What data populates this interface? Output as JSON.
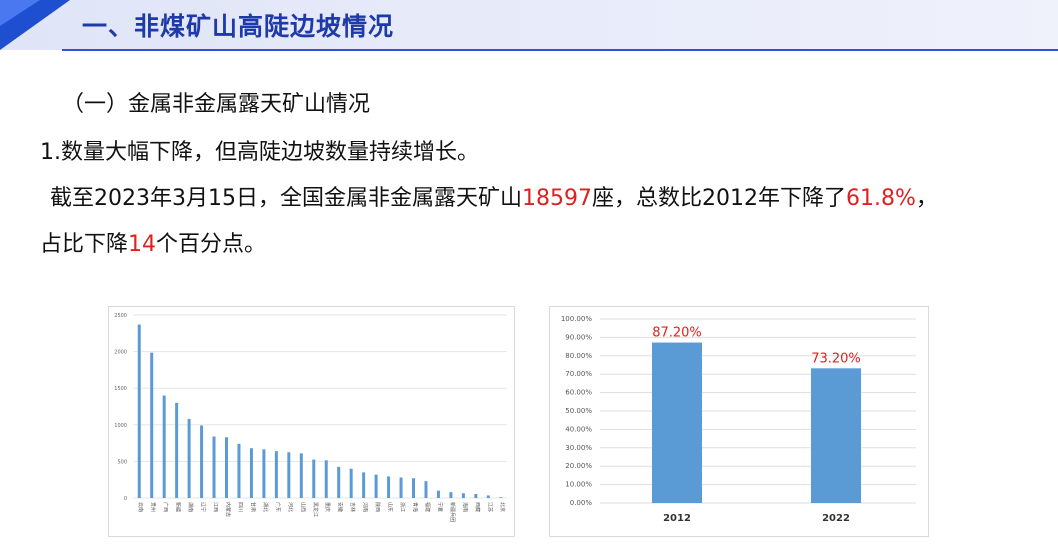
{
  "header": {
    "title": "一、非煤矿山高陡边坡情况"
  },
  "content": {
    "subheading": "（一）金属非金属露天矿山情况",
    "line1": "1.数量大幅下降，但高陡边坡数量持续增长。",
    "line2_a": "截至2023年3月15日，全国金属非金属露天矿山",
    "line2_num": "18597",
    "line2_b": "座，总数比2012年下降了",
    "line2_pct": "61.8%",
    "line2_c": "，",
    "line3_a": "占比下降",
    "line3_num": "14",
    "line3_b": "个百分点。"
  },
  "colors": {
    "accent": "#1f4fd1",
    "bar": "#5b9bd5",
    "highlight": "#e02020"
  },
  "chart_data": [
    {
      "type": "bar",
      "categories": [
        "云南",
        "贵州",
        "广西",
        "新疆",
        "湖南",
        "辽宁",
        "江西",
        "内蒙古",
        "四川",
        "甘肃",
        "湖北",
        "广东",
        "河北",
        "山西",
        "黑龙江",
        "重庆",
        "安徽",
        "吉林",
        "河南",
        "陕西",
        "山东",
        "浙江",
        "青海",
        "福建",
        "宁夏",
        "新疆兵团",
        "海南",
        "西藏",
        "江苏",
        "北京"
      ],
      "values": [
        2370,
        1985,
        1400,
        1300,
        1080,
        990,
        840,
        830,
        740,
        680,
        665,
        640,
        625,
        610,
        525,
        515,
        425,
        400,
        350,
        320,
        295,
        280,
        270,
        230,
        100,
        80,
        65,
        55,
        35,
        10
      ],
      "ylim": [
        0,
        2500
      ],
      "yticks": [
        "0",
        "500",
        "1000",
        "1500",
        "2000",
        "2500"
      ],
      "grid": true
    },
    {
      "type": "bar",
      "categories": [
        "2012",
        "2022"
      ],
      "values": [
        87.2,
        73.2
      ],
      "data_labels": [
        "87.20%",
        "73.20%"
      ],
      "ylim": [
        0,
        100
      ],
      "yticks": [
        "0.00%",
        "10.00%",
        "20.00%",
        "30.00%",
        "40.00%",
        "50.00%",
        "60.00%",
        "70.00%",
        "80.00%",
        "90.00%",
        "100.00%"
      ],
      "grid": true
    }
  ]
}
